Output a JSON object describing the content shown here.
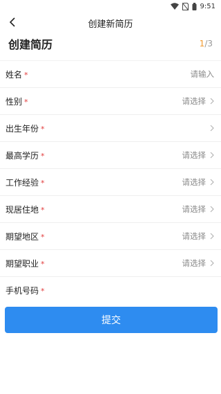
{
  "status": {
    "time": "9:51"
  },
  "nav": {
    "title": "创建新简历"
  },
  "header": {
    "title": "创建简历",
    "progress_current": "1",
    "progress_total": "/3"
  },
  "form": {
    "rows": [
      {
        "label": "姓名",
        "required": "*",
        "value": "请输入",
        "chevron": false
      },
      {
        "label": "性别",
        "required": "*",
        "value": "请选择",
        "chevron": true
      },
      {
        "label": "出生年份",
        "required": "*",
        "value": "",
        "chevron": true
      },
      {
        "label": "最高学历",
        "required": "*",
        "value": "请选择",
        "chevron": true
      },
      {
        "label": "工作经验",
        "required": "*",
        "value": "请选择",
        "chevron": true
      },
      {
        "label": "现居住地",
        "required": "*",
        "value": "请选择",
        "chevron": true
      },
      {
        "label": "期望地区",
        "required": "*",
        "value": "请选择",
        "chevron": true
      },
      {
        "label": "期望职业",
        "required": "*",
        "value": "请选择",
        "chevron": true
      },
      {
        "label": "手机号码",
        "required": "*",
        "value": "",
        "chevron": false
      }
    ]
  },
  "submit_label": "提交",
  "colors": {
    "accent": "#2e8cf0",
    "progress": "#f29a2e",
    "required": "#e23b3b"
  },
  "icons": {
    "back": "back-arrow-icon",
    "chevron": "chevron-right-icon"
  }
}
